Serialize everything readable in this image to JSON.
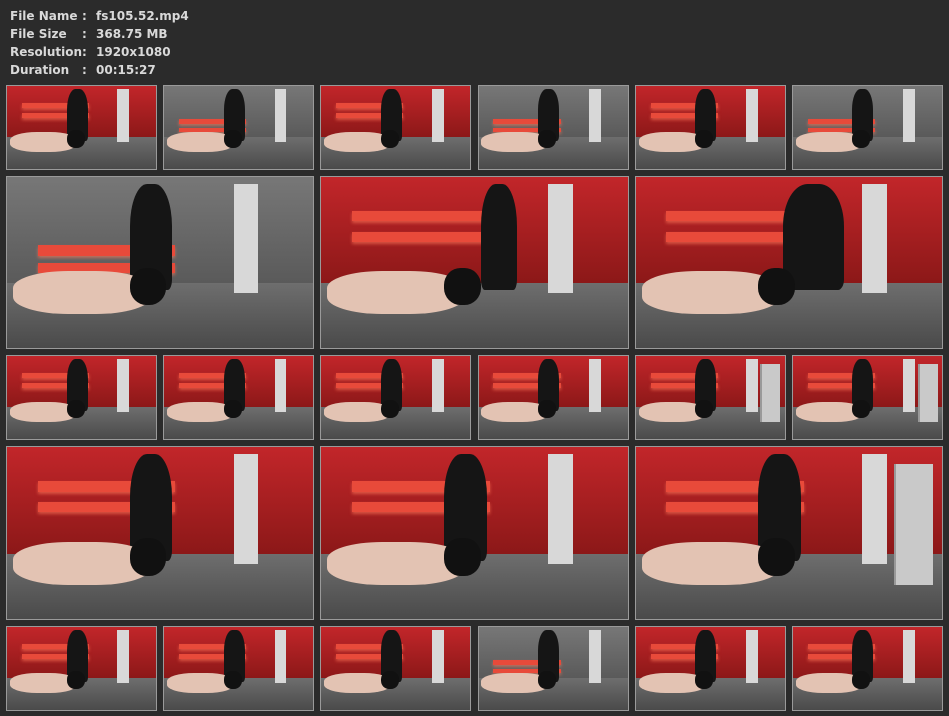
{
  "info": {
    "file_name": {
      "label": "File Name",
      "sep": ":",
      "value": "fs105.52.mp4"
    },
    "file_size": {
      "label": "File Size",
      "sep": ":",
      "value": "368.75 MB"
    },
    "resolution": {
      "label": "Resolution",
      "sep": ":",
      "value": "1920x1080"
    },
    "duration": {
      "label": "Duration",
      "sep": ":",
      "value": "00:15:27"
    }
  },
  "colors": {
    "background": "#2b2b2b",
    "text": "#d9d9d9",
    "border": "#9a9a9a",
    "wall_red": "#c2262a",
    "neon": "#e84a3a"
  },
  "thumbnails": [
    {
      "scene": "red",
      "variant": "standing-kneel"
    },
    {
      "scene": "gray",
      "variant": "seated-floor"
    },
    {
      "scene": "red",
      "variant": "crouch"
    },
    {
      "scene": "gray",
      "variant": "standing-floor"
    },
    {
      "scene": "red",
      "variant": "crouch"
    },
    {
      "scene": "gray",
      "variant": "standing-floor"
    },
    {
      "scene": "gray",
      "variant": "room-wide"
    },
    {
      "scene": "red",
      "variant": "closeup-floor"
    },
    {
      "scene": "red",
      "variant": "closeup-crouch"
    },
    {
      "scene": "red",
      "variant": "seated-floor"
    },
    {
      "scene": "red",
      "variant": "seated-floor"
    },
    {
      "scene": "red",
      "variant": "seated-floor"
    },
    {
      "scene": "red",
      "variant": "seated-floor"
    },
    {
      "scene": "red",
      "variant": "floor-mirror"
    },
    {
      "scene": "red",
      "variant": "floor-mirror"
    },
    {
      "scene": "red",
      "variant": "seated-floor"
    },
    {
      "scene": "red",
      "variant": "seated-floor"
    },
    {
      "scene": "red",
      "variant": "floor-mirror"
    },
    {
      "scene": "red",
      "variant": "seated-floor"
    },
    {
      "scene": "red",
      "variant": "seated-floor"
    },
    {
      "scene": "red",
      "variant": "seated-floor"
    },
    {
      "scene": "gray",
      "variant": "room-wide"
    },
    {
      "scene": "red",
      "variant": "seated-floor"
    },
    {
      "scene": "red",
      "variant": "seated-floor"
    }
  ]
}
